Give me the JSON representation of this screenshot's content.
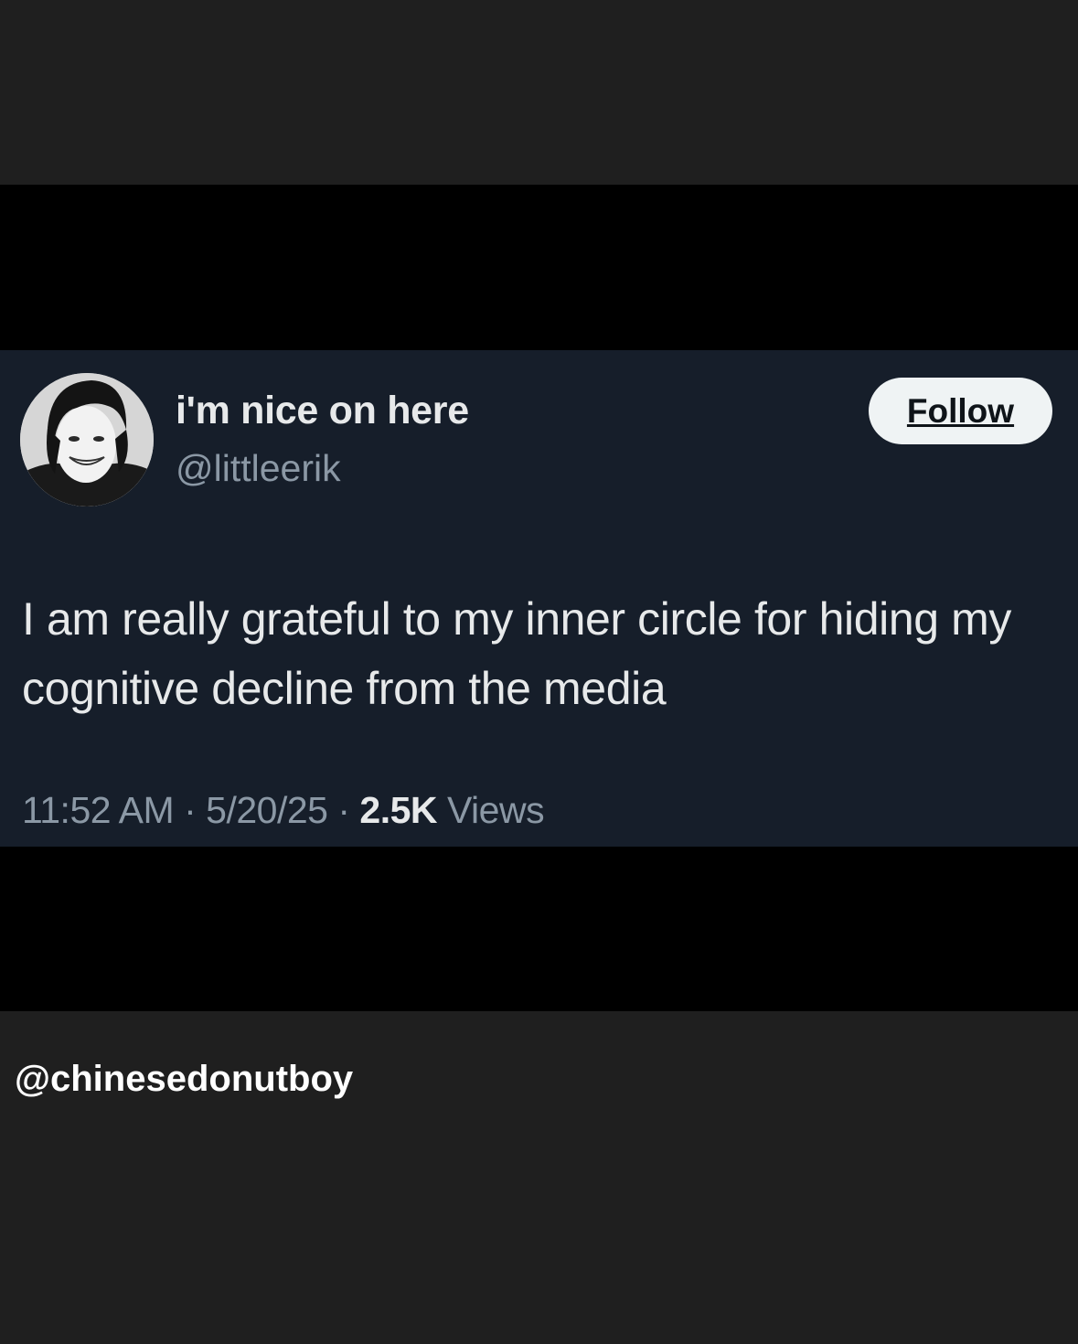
{
  "tweet": {
    "author": {
      "display_name": "i'm nice on here",
      "handle": "@littleerik"
    },
    "follow_label": "Follow",
    "text": "I am really grateful to my inner circle for hiding my cognitive decline from the media",
    "time": "11:52 AM",
    "separator": "·",
    "date": "5/20/25",
    "views_count": "2.5K",
    "views_label": "Views"
  },
  "credit": "@chinesedonutboy",
  "colors": {
    "outer_background": "#1f1f1f",
    "band": "#000000",
    "card_background": "#161e2a",
    "primary_text": "#e7e9ea",
    "secondary_text": "#8b98a5",
    "follow_button_bg": "#eff3f4"
  }
}
